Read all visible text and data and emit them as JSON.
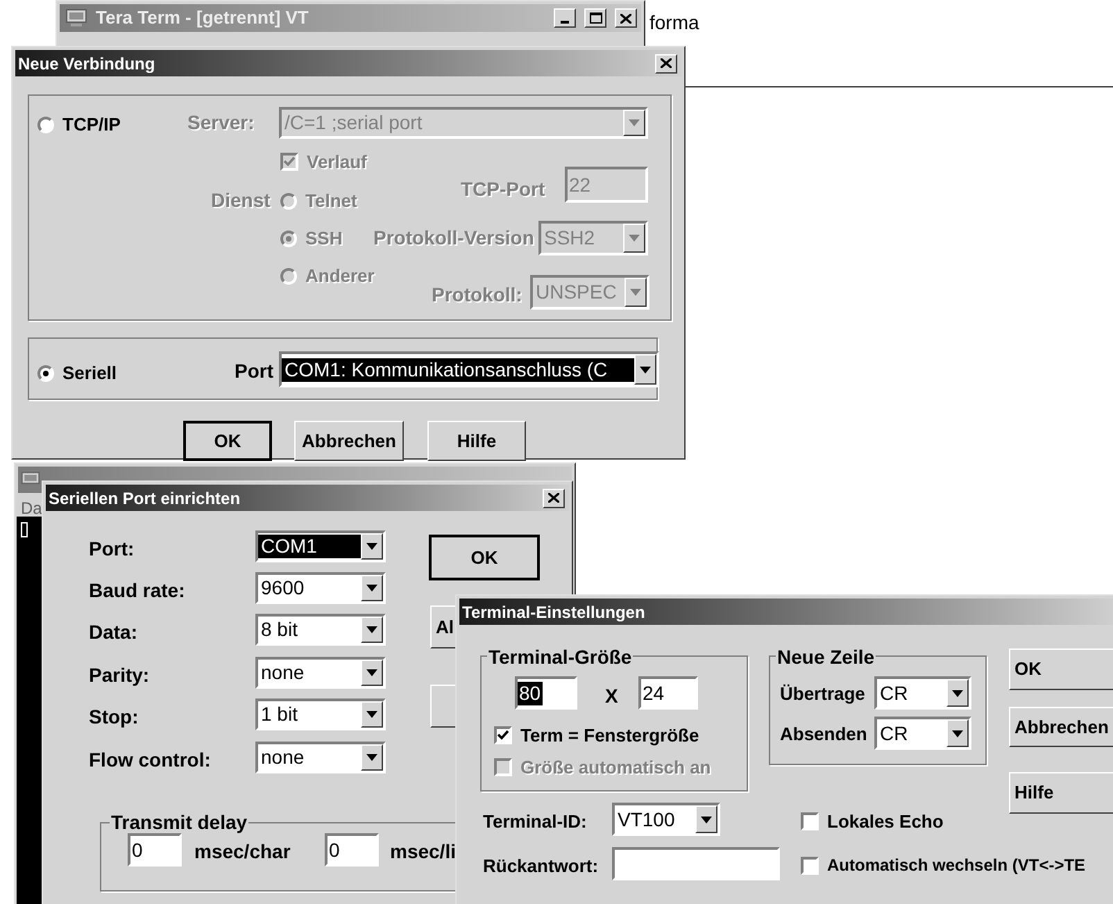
{
  "background_window": {
    "title": "Tera Term - [getrennt] VT"
  },
  "background_text": "forma",
  "new_connection": {
    "title": "Neue Verbindung",
    "tcp": {
      "label": "TCP/IP",
      "selected": false,
      "disabled": true,
      "server_label": "Server:",
      "server": "/C=1 ;serial port",
      "history": {
        "label": "Verlauf",
        "checked": true
      },
      "service_label": "Dienst",
      "services": [
        {
          "label": "Telnet",
          "selected": false
        },
        {
          "label": "SSH",
          "selected": true
        },
        {
          "label": "Anderer",
          "selected": false
        }
      ],
      "tcp_port_label": "TCP-Port",
      "tcp_port": "22",
      "protocol_version_label": "Protokoll-Version",
      "protocol_version": "SSH2",
      "protocol_label": "Protokoll:",
      "protocol": "UNSPEC"
    },
    "serial": {
      "label": "Seriell",
      "selected": true,
      "port_label": "Port",
      "port": "COM1: Kommunikationsanschluss (C",
      "highlighted": true
    },
    "buttons": [
      {
        "label": "OK",
        "default": true
      },
      {
        "label": "Abbrechen",
        "default": false
      },
      {
        "label": "Hilfe",
        "default": false
      }
    ]
  },
  "com1_window": {
    "menu": "Da"
  },
  "serial_port": {
    "title": "Seriellen Port einrichten",
    "settings": [
      {
        "label": "Port:",
        "value": "COM1",
        "highlighted": true
      },
      {
        "label": "Baud rate:",
        "value": "9600",
        "highlighted": false
      },
      {
        "label": "Data:",
        "value": "8 bit",
        "highlighted": false
      },
      {
        "label": "Parity:",
        "value": "none",
        "highlighted": false
      },
      {
        "label": "Stop:",
        "value": "1 bit",
        "highlighted": false
      },
      {
        "label": "Flow control:",
        "value": "none",
        "highlighted": false
      }
    ],
    "buttons": [
      {
        "label": "OK"
      },
      {
        "label": "Al"
      }
    ],
    "transmit_delay": {
      "label": "Transmit delay",
      "char_value": "0",
      "char_unit": "msec/char",
      "line_value": "0",
      "line_unit": "msec/li"
    }
  },
  "terminal": {
    "title": "Terminal-Einstellungen",
    "size_group": "Terminal-Größe",
    "columns": "80",
    "columns_highlighted": true,
    "times": "X",
    "rows": "24",
    "term_window": {
      "label": "Term = Fenstergröße",
      "checked": true,
      "disabled": false
    },
    "auto_size": {
      "label": "Größe automatisch an",
      "checked": false,
      "disabled": true
    },
    "newline_group": "Neue Zeile",
    "receive_label": "Übertrage",
    "receive": "CR",
    "transmit_label": "Absenden",
    "transmit": "CR",
    "terminal_id_label": "Terminal-ID:",
    "terminal_id": "VT100",
    "answerback_label": "Rückantwort:",
    "local_echo": {
      "label": "Lokales Echo",
      "checked": false
    },
    "auto_switch": {
      "label": "Automatisch wechseln (VT<->TE",
      "checked": false
    },
    "buttons": [
      {
        "label": "OK"
      },
      {
        "label": "Abbrechen"
      },
      {
        "label": "Hilfe"
      }
    ]
  }
}
